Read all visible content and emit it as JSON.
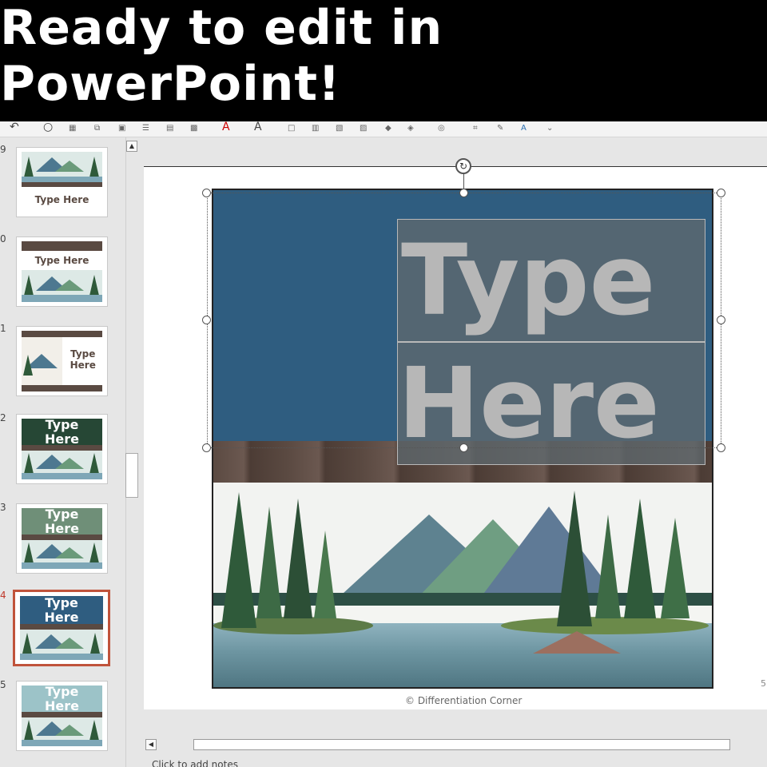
{
  "banner": {
    "text": "Ready to edit in PowerPoint!"
  },
  "thumbnails": [
    {
      "number": "9",
      "label_line1": "Type Here",
      "label_line2": ""
    },
    {
      "number": "0",
      "label_line1": "Type Here",
      "label_line2": ""
    },
    {
      "number": "1",
      "label_line1": "Type",
      "label_line2": "Here"
    },
    {
      "number": "2",
      "label_line1": "Type",
      "label_line2": "Here",
      "top_color": "#264735"
    },
    {
      "number": "3",
      "label_line1": "Type",
      "label_line2": "Here",
      "top_color": "#6f8f78"
    },
    {
      "number": "4",
      "label_line1": "Type",
      "label_line2": "Here",
      "top_color": "#2f5d80",
      "selected": true
    },
    {
      "number": "5",
      "label_line1": "Type",
      "label_line2": "Here",
      "top_color": "#9cc3c8"
    }
  ],
  "slide": {
    "title_line1": "Type",
    "title_line2": "Here",
    "top_color": "#2f5d80",
    "copyright": "© Differentiation Corner",
    "slide_number": "5"
  },
  "notes_placeholder": "Click to add notes",
  "colors": {
    "selected_border": "#c0533b",
    "text_placeholder": "#b7b7b7"
  }
}
